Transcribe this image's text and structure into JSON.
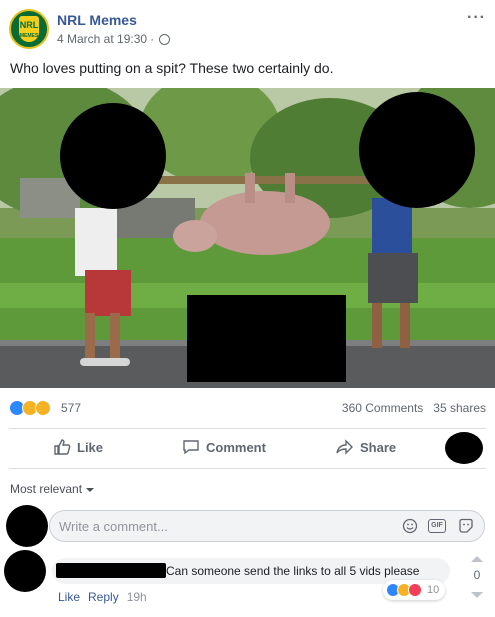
{
  "post": {
    "page_name": "NRL Memes",
    "logo_text": "NRL",
    "logo_subtext": "MEMES",
    "timestamp": "4 March at 19:30",
    "separator": "·",
    "privacy_icon": "globe-icon",
    "more_label": "···",
    "caption": "Who loves putting on a spit? These two certainly do.",
    "photo_alt": "Two men carrying a pig on a pole"
  },
  "stats": {
    "reaction_icons": [
      "like-icon",
      "haha-icon",
      "wow-icon"
    ],
    "reaction_count": "577",
    "comments": "360 Comments",
    "shares": "35 shares"
  },
  "actions": {
    "like_label": "Like",
    "comment_label": "Comment",
    "share_label": "Share"
  },
  "comments": {
    "sort_label": "Most relevant",
    "input_placeholder": "Write a comment...",
    "input_icons": [
      "emoji-icon",
      "gif-icon",
      "sticker-icon"
    ],
    "gif_label": "GIF",
    "items": [
      {
        "text": "Can someone send the links to all 5 vids please",
        "like_label": "Like",
        "reply_label": "Reply",
        "time": "19h",
        "reaction_count": "10",
        "vote_count": "0"
      }
    ]
  },
  "colors": {
    "link_blue": "#385898",
    "like_blue": "#2d88ff",
    "love_red": "#f33e58",
    "haha_yellow": "#f7b125",
    "divider": "#dadde1"
  }
}
